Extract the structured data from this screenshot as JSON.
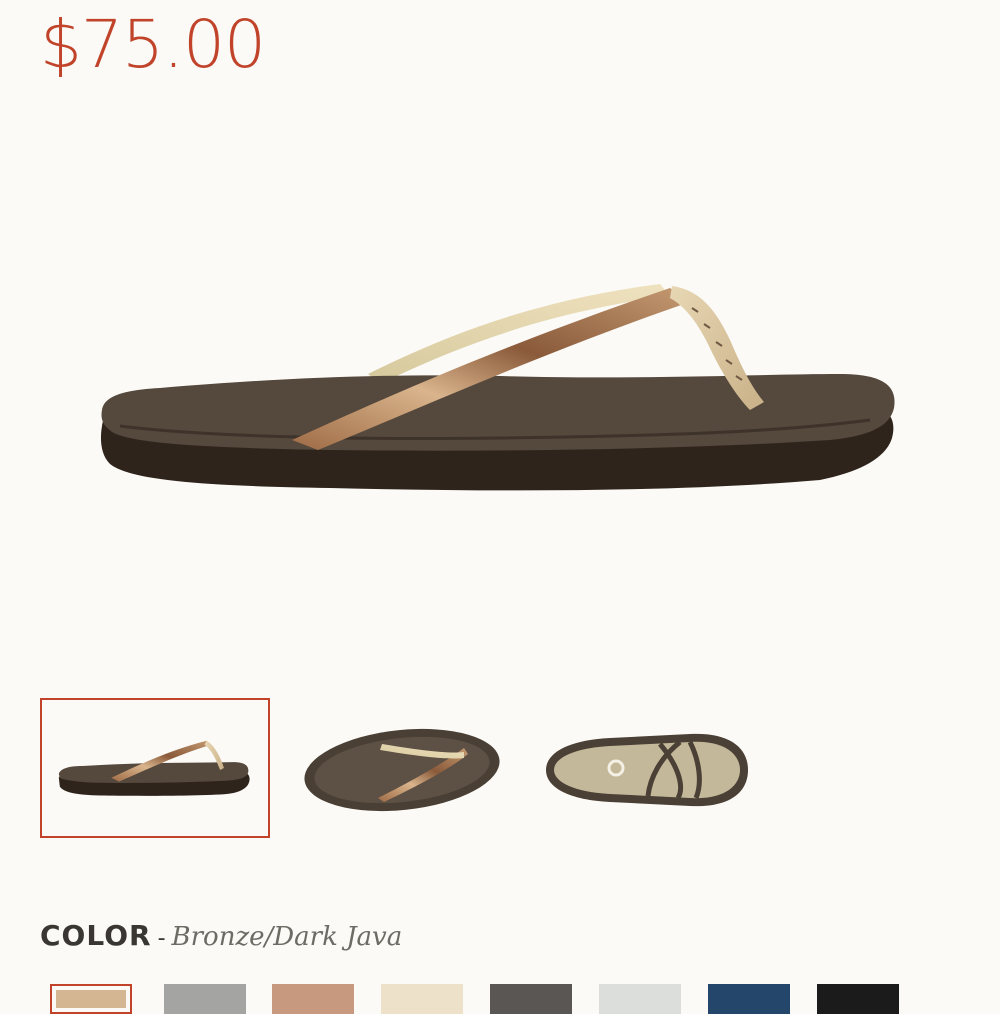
{
  "product": {
    "price": "$75.00",
    "hero_image": "bronze-dark-java-sandal-side-view"
  },
  "gallery": {
    "thumbnails": [
      {
        "name": "thumbnail-side-view",
        "selected": true
      },
      {
        "name": "thumbnail-top-view",
        "selected": false
      },
      {
        "name": "thumbnail-sole-view",
        "selected": false
      }
    ]
  },
  "color": {
    "label": "COLOR",
    "separator": "-",
    "selected_value": "Bronze/Dark Java",
    "swatches": [
      {
        "color": "#d4b693",
        "selected": true
      },
      {
        "color": "#a4a4a2",
        "selected": false
      },
      {
        "color": "#c79a80",
        "selected": false
      },
      {
        "color": "#ede1c9",
        "selected": false
      },
      {
        "color": "#5a5653",
        "selected": false
      },
      {
        "color": "#dcdedb",
        "selected": false
      },
      {
        "color": "#23466a",
        "selected": false
      },
      {
        "color": "#1b1b1b",
        "selected": false
      }
    ]
  },
  "colors": {
    "accent": "#c0432a",
    "background": "#fbfaf6",
    "sole": "#2f241c",
    "footbed": "#55483d",
    "strap_bronze": "#b58a62"
  }
}
